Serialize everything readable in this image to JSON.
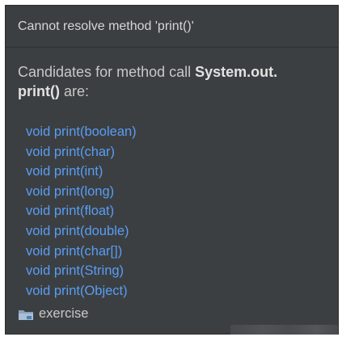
{
  "popup": {
    "title": "Cannot resolve method 'print()'",
    "description_prefix": "Candidates for method call ",
    "description_bold": "System.out.\nprint()",
    "description_suffix": " are:",
    "candidates": [
      "void print(boolean)",
      "void print(char)",
      "void print(int)",
      "void print(long)",
      "void print(float)",
      "void print(double)",
      "void print(char[])",
      "void print(String)",
      "void print(Object)"
    ],
    "module": {
      "icon": "folder-module-icon",
      "name": "exercise"
    }
  },
  "colors": {
    "background": "#3c3f41",
    "link": "#589df6",
    "text": "#c8c8c8"
  }
}
